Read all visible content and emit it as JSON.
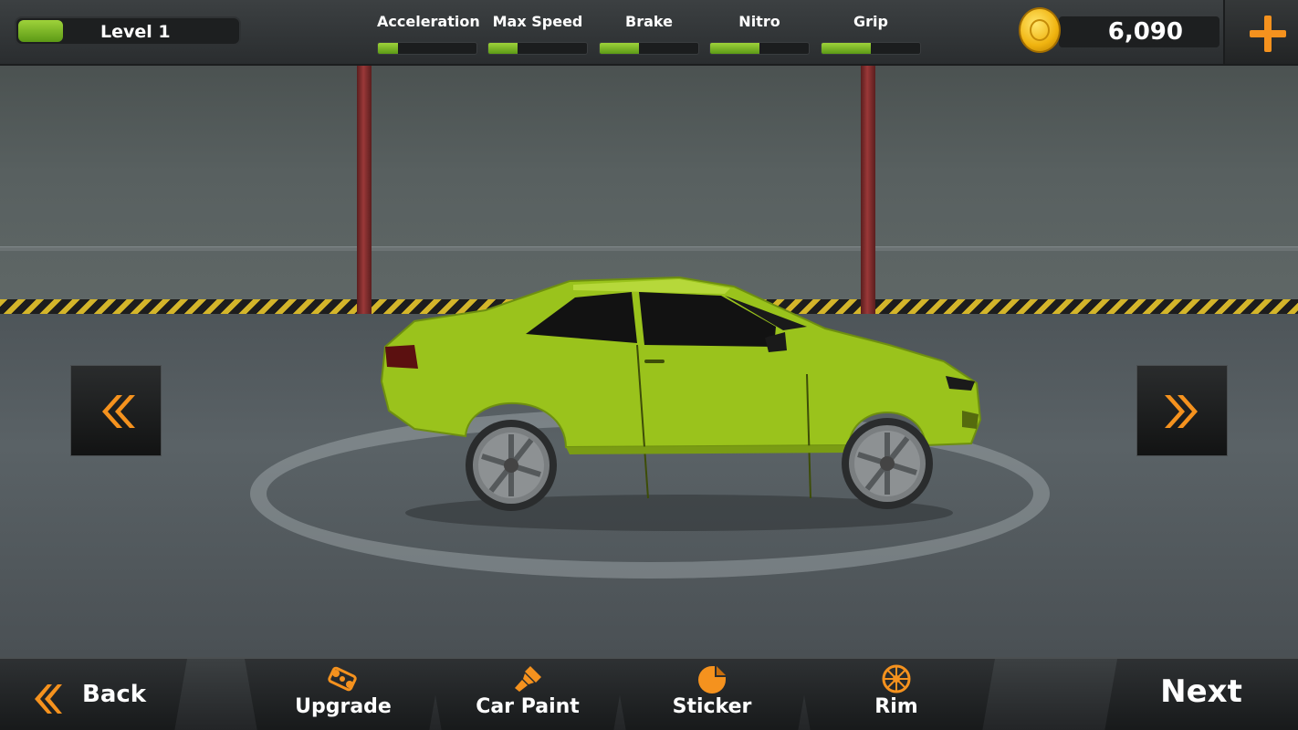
{
  "hud": {
    "level_label": "Level 1",
    "level_progress": 0.2,
    "stats": [
      {
        "label": "Acceleration",
        "value": 0.2
      },
      {
        "label": "Max Speed",
        "value": 0.3
      },
      {
        "label": "Brake",
        "value": 0.4
      },
      {
        "label": "Nitro",
        "value": 0.5
      },
      {
        "label": "Grip",
        "value": 0.5
      }
    ],
    "coins": "6,090",
    "plus_icon": "plus-icon",
    "coin_icon": "coin-icon"
  },
  "car": {
    "color": "#9ac31c"
  },
  "nav": {
    "prev_icon": "double-chevron-left-icon",
    "next_icon": "double-chevron-right-icon"
  },
  "bottom": {
    "back_label": "Back",
    "upgrade_label": "Upgrade",
    "paint_label": "Car Paint",
    "sticker_label": "Sticker",
    "rim_label": "Rim",
    "next_label": "Next"
  },
  "colors": {
    "accent": "#f5921e",
    "bar_green": "#7bb827"
  }
}
